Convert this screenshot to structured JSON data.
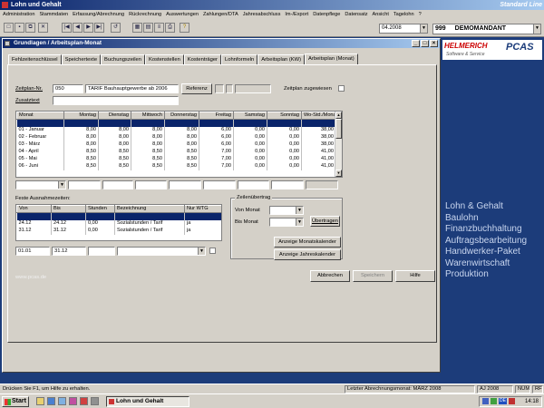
{
  "app": {
    "title": "Lohn und Gehalt",
    "edition": "Standard Line"
  },
  "menu": [
    "Administration",
    "Stammdaten",
    "Erfassung/Abrechnung",
    "Rückrechnung",
    "Auswertungen",
    "Zahlungen/DTA",
    "Jahresabschluss",
    "Im-/Export",
    "Datenpflege",
    "Datensatz",
    "Ansicht",
    "Tagelohn",
    "?"
  ],
  "toolbar": {
    "date": "04.2008",
    "mandant_nr": "999",
    "mandant_name": "DEMOMANDANT"
  },
  "window": {
    "title": "Grundlagen / Arbeitsplan-Monat"
  },
  "tabs": [
    "Fehlzeitenschlüssel",
    "Speichertexte",
    "Buchungszeilen",
    "Kostenstellen",
    "Kostenträger",
    "Lohnformeln",
    "Arbeitsplan (KW)",
    "Arbeitsplan (Monat)"
  ],
  "form": {
    "zeitplan_label": "Zeitplan-Nr.",
    "zeitplan_nr": "050",
    "zeitplan_name": "TARIF Bauhauptgewerbe ab 2006",
    "referenz_label": "Referenz",
    "zusatztext_label": "Zusatztext",
    "zugewiesen_label": "Zeitplan zugewiesen"
  },
  "grid": {
    "headers": [
      "Monat",
      "Montag",
      "Dienstag",
      "Mittwoch",
      "Donnerstag",
      "Freitag",
      "Samstag",
      "Sonntag",
      "Wo-Std./Monat"
    ],
    "rows": [
      [
        "01 - Januar",
        "8,00",
        "8,00",
        "8,00",
        "8,00",
        "6,00",
        "0,00",
        "0,00",
        "38,00"
      ],
      [
        "02 - Februar",
        "8,00",
        "8,00",
        "8,00",
        "8,00",
        "6,00",
        "0,00",
        "0,00",
        "38,00"
      ],
      [
        "03 - März",
        "8,00",
        "8,00",
        "8,00",
        "8,00",
        "6,00",
        "0,00",
        "0,00",
        "38,00"
      ],
      [
        "04 - April",
        "8,50",
        "8,50",
        "8,50",
        "8,50",
        "7,00",
        "0,00",
        "0,00",
        "41,00"
      ],
      [
        "05 - Mai",
        "8,50",
        "8,50",
        "8,50",
        "8,50",
        "7,00",
        "0,00",
        "0,00",
        "41,00"
      ],
      [
        "06 - Juni",
        "8,50",
        "8,50",
        "8,50",
        "8,50",
        "7,00",
        "0,00",
        "0,00",
        "41,00"
      ]
    ]
  },
  "ausnahmen": {
    "title": "Feste Ausnahmezeiten:",
    "headers": [
      "Von",
      "Bis",
      "Stunden",
      "Bezeichnung",
      "Nur WTG"
    ],
    "rows": [
      [
        "",
        "",
        "",
        "",
        ""
      ],
      [
        "24.12",
        "24.12",
        "0,00",
        "Sozialstunden / Tarif",
        "ja"
      ],
      [
        "31.12",
        "31.12",
        "0,00",
        "Sozialstunden / Tarif",
        "ja"
      ]
    ],
    "input_von": "01.01",
    "input_bis": "31.12"
  },
  "zeilen": {
    "title": "Zeilenübertrag",
    "von_label": "Von Monat",
    "bis_label": "Bis Monat",
    "uebertragen": "Übertragen"
  },
  "buttons": {
    "monatskalender": "Anzeige Monatskalender",
    "jahreskalender": "Anzeige Jahreskalender",
    "abbrechen": "Abbrechen",
    "speichern": "Speichern",
    "hilfe": "Hilfe"
  },
  "watermark": "www.pcas.de",
  "sidebar": {
    "logo_text": "HELMERICH",
    "logo_sub": "Software & Service",
    "pcas": "PCAS",
    "products": [
      "Lohn & Gehalt",
      "Baulohn",
      "Finanzbuchhaltung",
      "Auftragsbearbeitung",
      "Handwerker-Paket",
      "Warenwirtschaft",
      "Produktion"
    ]
  },
  "status": {
    "help": "Drücken Sie F1, um Hilfe zu erhalten.",
    "abrechnung": "Letzter Abrechnungsmonat: MÄRZ 2008",
    "aj": "AJ 2008",
    "num": "NUM",
    "rf": "RF"
  },
  "taskbar": {
    "start": "Start",
    "task": "Lohn und Gehalt",
    "time": "14:18"
  }
}
